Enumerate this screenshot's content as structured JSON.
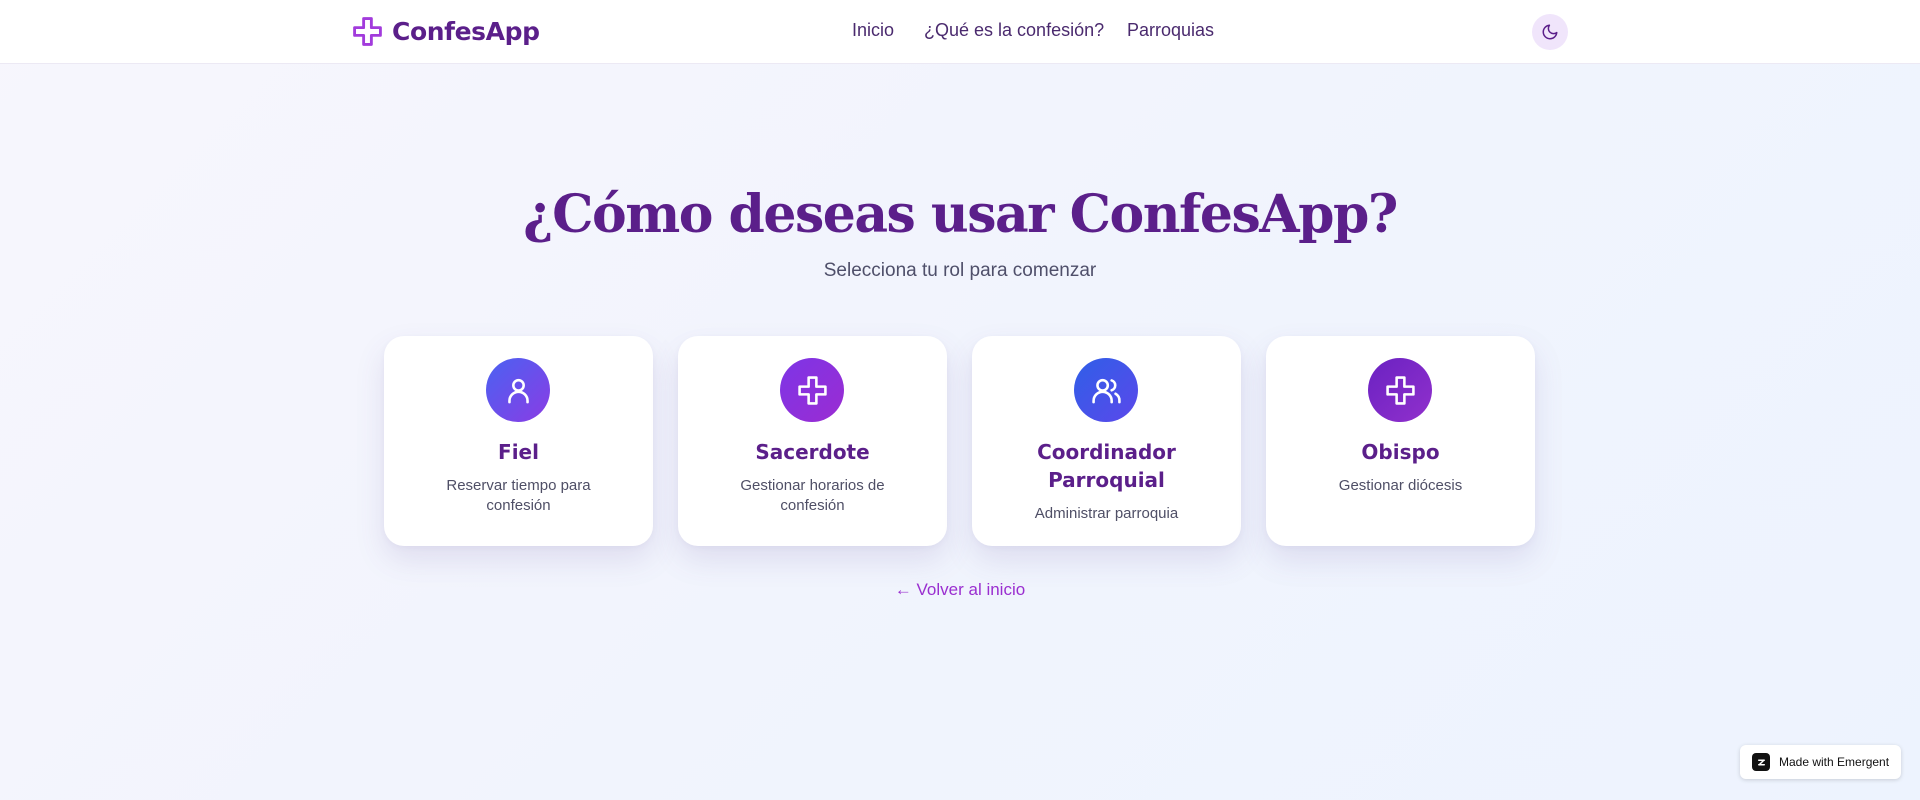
{
  "header": {
    "brand": {
      "name": "ConfesApp",
      "icon": "cross-icon"
    },
    "nav": [
      {
        "label": "Inicio"
      },
      {
        "label": "¿Qué es la confesión?"
      },
      {
        "label": "Parroquias"
      }
    ],
    "theme_toggle": {
      "icon": "moon-icon"
    }
  },
  "main": {
    "title": "¿Cómo deseas usar ConfesApp?",
    "subtitle": "Selecciona tu rol para comenzar",
    "roles": [
      {
        "title": "Fiel",
        "description": "Reservar tiempo para confesión",
        "icon": "user-icon"
      },
      {
        "title": "Sacerdote",
        "description": "Gestionar horarios de confesión",
        "icon": "cross-icon"
      },
      {
        "title": "Coordinador Parroquial",
        "description": "Administrar parroquia",
        "icon": "users-icon"
      },
      {
        "title": "Obispo",
        "description": "Gestionar diócesis",
        "icon": "cross-icon"
      }
    ],
    "back_link": "← Volver al inicio"
  },
  "badge": {
    "text": "Made with Emergent"
  },
  "colors": {
    "brand": "#5b1f8a",
    "accent": "#9a2fd0",
    "icon_fiel": "#5a57f0",
    "icon_sacerdote": "#8a2ee0",
    "icon_coordinador": "#3d5cef",
    "icon_obispo": "#7a22c4"
  }
}
